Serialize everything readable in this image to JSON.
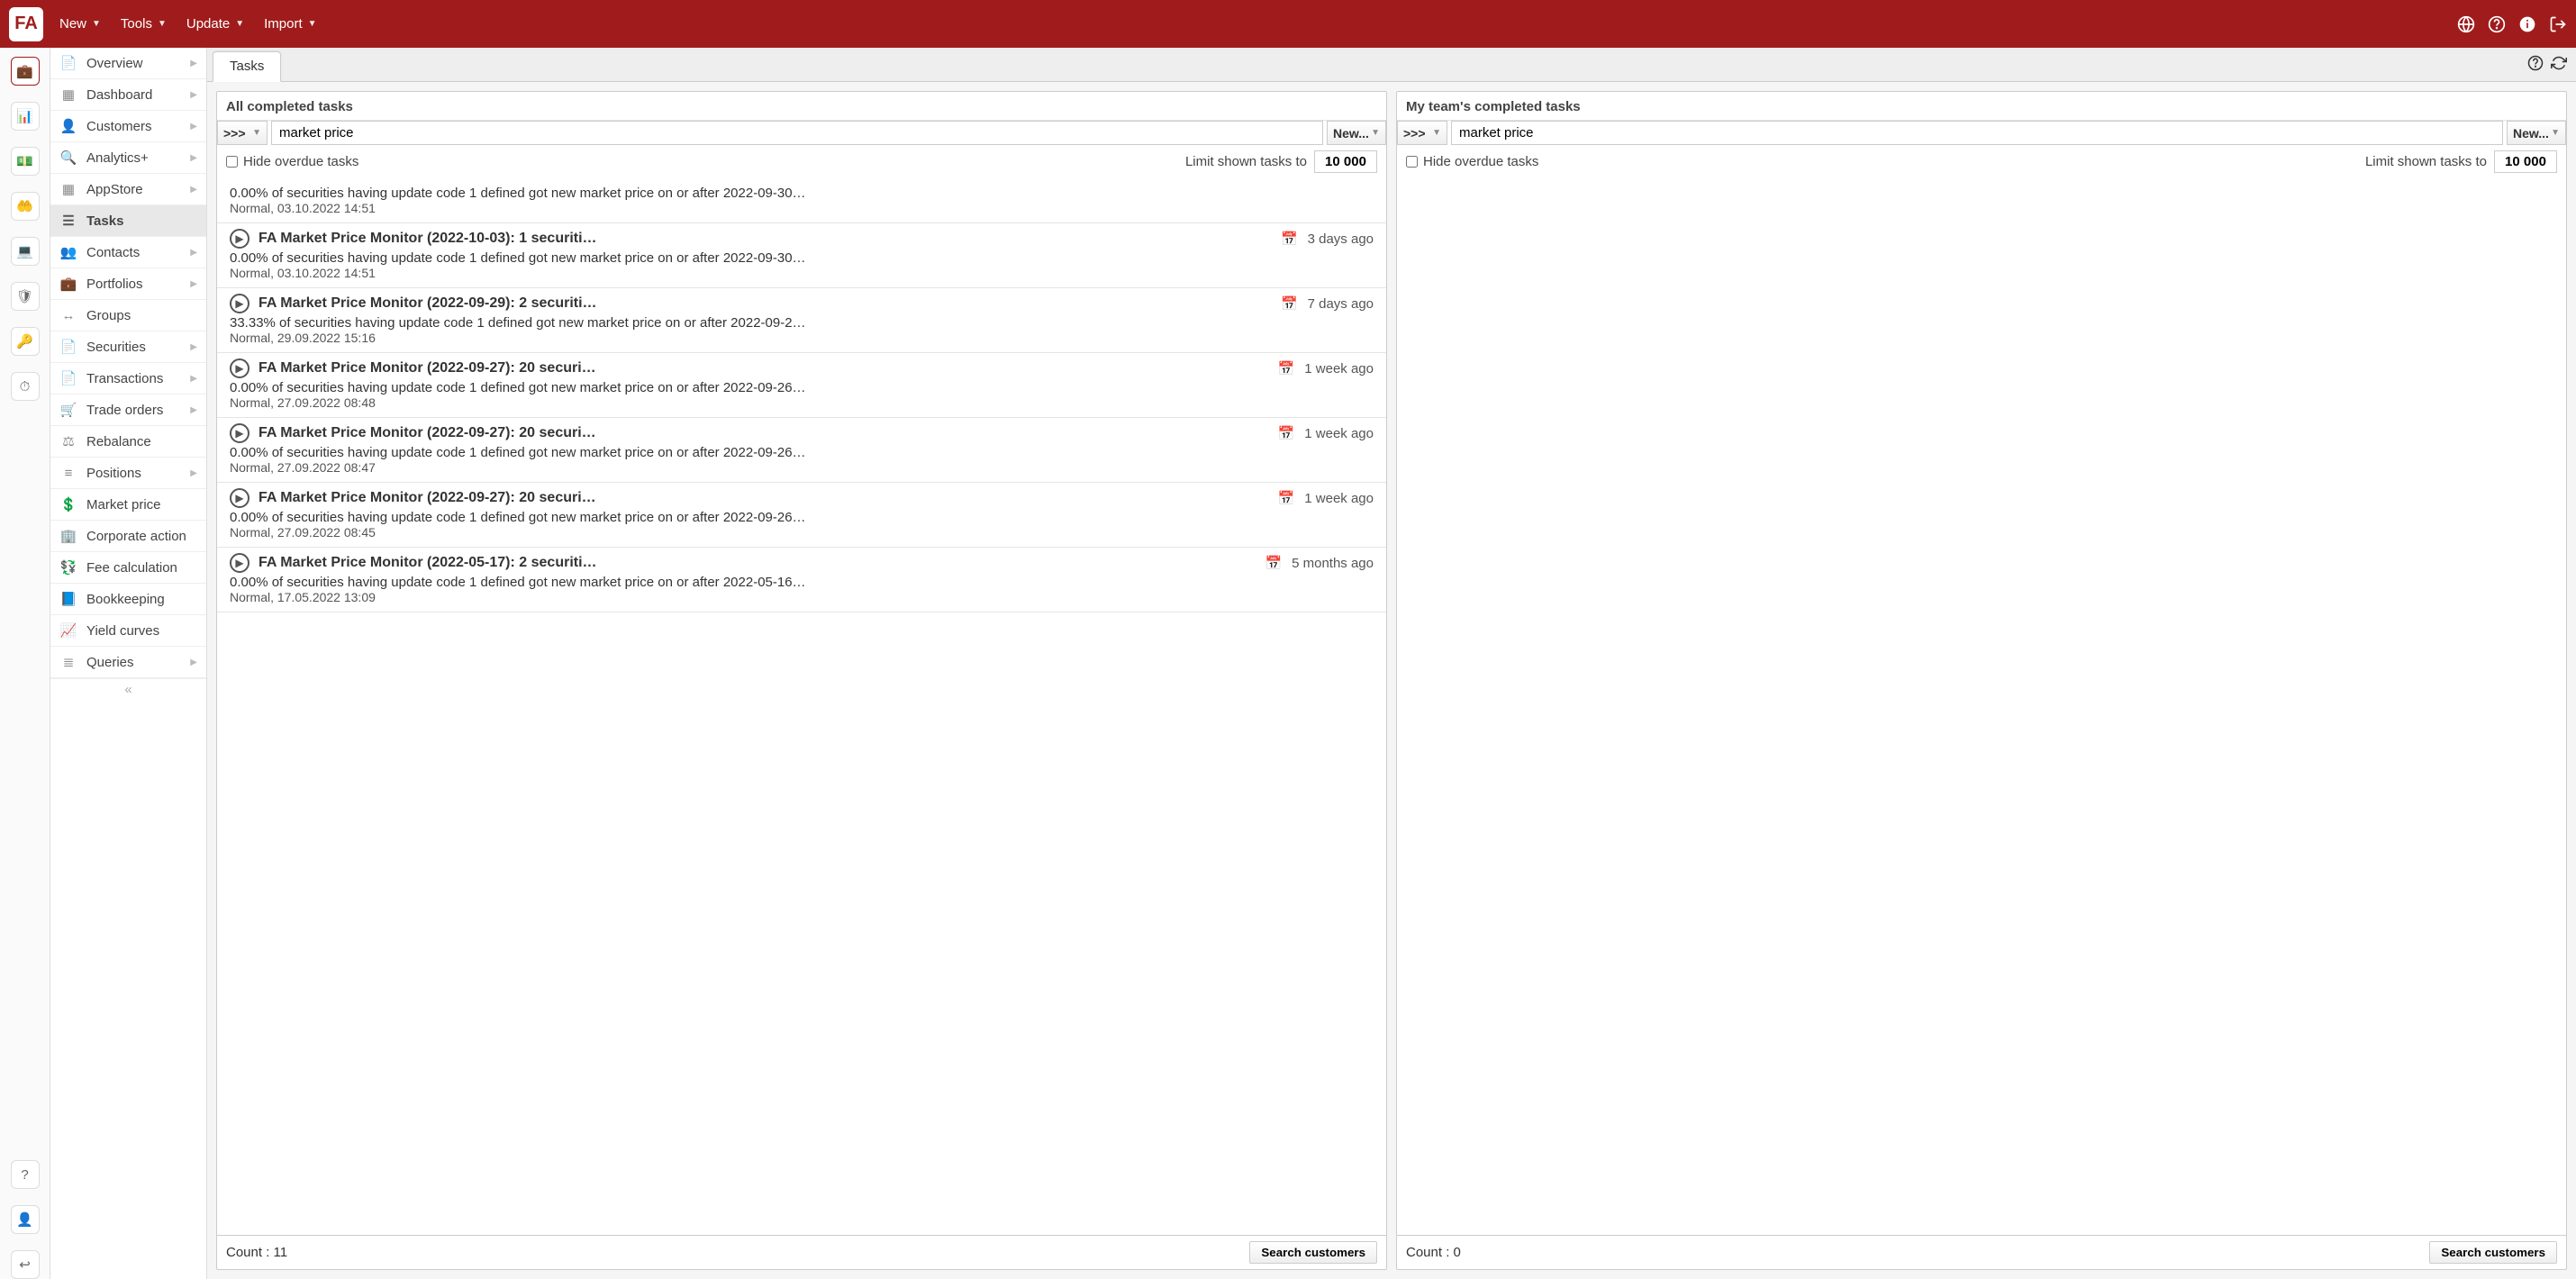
{
  "topbar": {
    "logo": "FA",
    "menus": [
      "New",
      "Tools",
      "Update",
      "Import"
    ]
  },
  "sidebar": {
    "items": [
      {
        "label": "Overview",
        "icon": "📄",
        "chev": true
      },
      {
        "label": "Dashboard",
        "icon": "▦",
        "chev": true
      },
      {
        "label": "Customers",
        "icon": "👤",
        "chev": true
      },
      {
        "label": "Analytics+",
        "icon": "🔍",
        "chev": true
      },
      {
        "label": "AppStore",
        "icon": "▦",
        "chev": true
      },
      {
        "label": "Tasks",
        "icon": "☰",
        "chev": false,
        "active": true
      },
      {
        "label": "Contacts",
        "icon": "👥",
        "chev": true
      },
      {
        "label": "Portfolios",
        "icon": "💼",
        "chev": true
      },
      {
        "label": "Groups",
        "icon": "↔",
        "chev": false
      },
      {
        "label": "Securities",
        "icon": "📄",
        "chev": true
      },
      {
        "label": "Transactions",
        "icon": "📄",
        "chev": true
      },
      {
        "label": "Trade orders",
        "icon": "🛒",
        "chev": true
      },
      {
        "label": "Rebalance",
        "icon": "⚖",
        "chev": false
      },
      {
        "label": "Positions",
        "icon": "≡",
        "chev": true
      },
      {
        "label": "Market price",
        "icon": "💲",
        "chev": false
      },
      {
        "label": "Corporate action",
        "icon": "🏢",
        "chev": false
      },
      {
        "label": "Fee calculation",
        "icon": "💱",
        "chev": false
      },
      {
        "label": "Bookkeeping",
        "icon": "📘",
        "chev": false
      },
      {
        "label": "Yield curves",
        "icon": "📈",
        "chev": false
      },
      {
        "label": "Queries",
        "icon": "≣",
        "chev": true
      }
    ]
  },
  "tab": {
    "label": "Tasks"
  },
  "left_panel": {
    "title": "All completed tasks",
    "selector": ">>>",
    "search": "market price",
    "new_label": "New...",
    "hide_label": "Hide overdue tasks",
    "limit_label": "Limit shown tasks to",
    "limit_value": "10 000",
    "count_label": "Count : 11",
    "search_btn": "Search customers",
    "tasks": [
      {
        "title": "",
        "age": "",
        "desc": "0.00% of securities having update code 1 defined got new market price on or after 2022-09-30…",
        "meta": "Normal, 03.10.2022 14:51",
        "partial": true
      },
      {
        "title": "FA Market Price Monitor (2022-10-03): 1 securiti…",
        "age": "3 days ago",
        "desc": "0.00% of securities having update code 1 defined got new market price on or after 2022-09-30…",
        "meta": "Normal, 03.10.2022 14:51"
      },
      {
        "title": "FA Market Price Monitor (2022-09-29): 2 securiti…",
        "age": "7 days ago",
        "desc": "33.33% of securities having update code 1 defined got new market price on or after 2022-09-2…",
        "meta": "Normal, 29.09.2022 15:16"
      },
      {
        "title": "FA Market Price Monitor (2022-09-27): 20 securi…",
        "age": "1 week ago",
        "desc": "0.00% of securities having update code 1 defined got new market price on or after 2022-09-26…",
        "meta": "Normal, 27.09.2022 08:48"
      },
      {
        "title": "FA Market Price Monitor (2022-09-27): 20 securi…",
        "age": "1 week ago",
        "desc": "0.00% of securities having update code 1 defined got new market price on or after 2022-09-26…",
        "meta": "Normal, 27.09.2022 08:47"
      },
      {
        "title": "FA Market Price Monitor (2022-09-27): 20 securi…",
        "age": "1 week ago",
        "desc": "0.00% of securities having update code 1 defined got new market price on or after 2022-09-26…",
        "meta": "Normal, 27.09.2022 08:45"
      },
      {
        "title": "FA Market Price Monitor (2022-05-17): 2 securiti…",
        "age": "5 months ago",
        "desc": "0.00% of securities having update code 1 defined got new market price on or after 2022-05-16…",
        "meta": "Normal, 17.05.2022 13:09"
      }
    ]
  },
  "right_panel": {
    "title": "My team's completed tasks",
    "selector": ">>>",
    "search": "market price",
    "new_label": "New...",
    "hide_label": "Hide overdue tasks",
    "limit_label": "Limit shown tasks to",
    "limit_value": "10 000",
    "count_label": "Count : 0",
    "search_btn": "Search customers",
    "tasks": []
  }
}
